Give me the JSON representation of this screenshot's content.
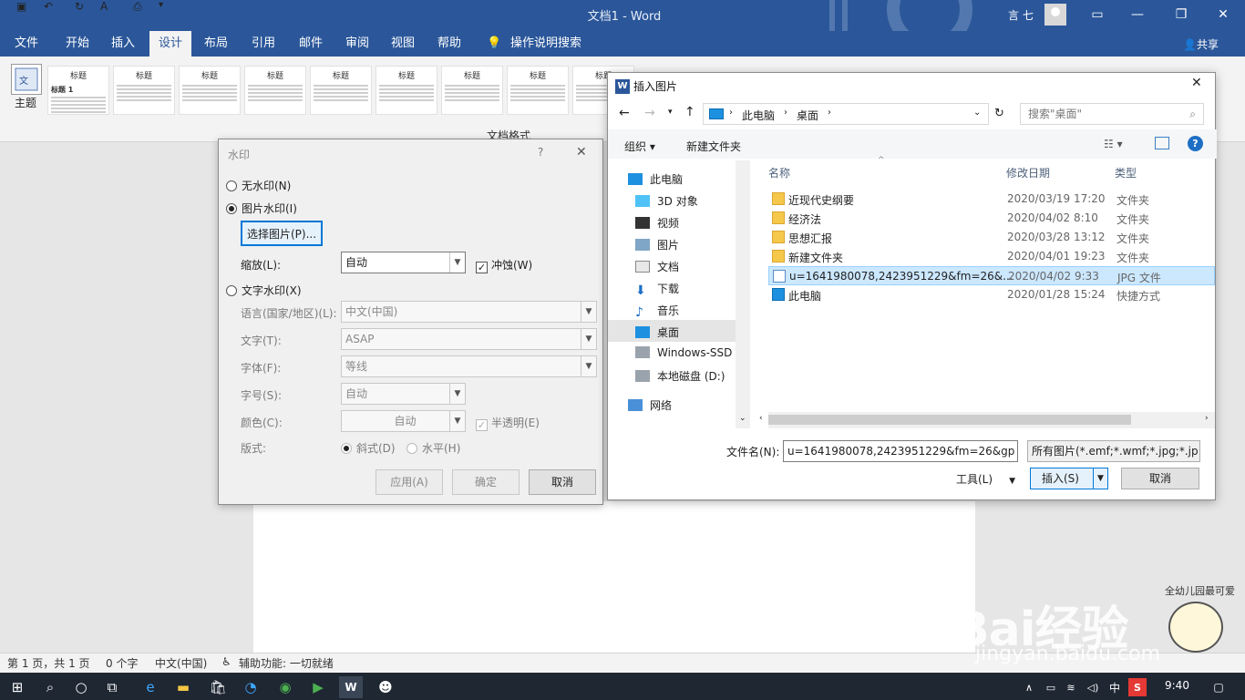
{
  "titlebar": {
    "doc_title": "文档1  -  Word",
    "user": "言 七"
  },
  "tabs": [
    "文件",
    "开始",
    "插入",
    "设计",
    "布局",
    "引用",
    "邮件",
    "审阅",
    "视图",
    "帮助"
  ],
  "tell_me": "操作说明搜索",
  "share": "共享",
  "ribbon": {
    "theme_label": "主题",
    "thumb_title": "标题",
    "thumb_heading1": "标题 1",
    "docformat_label": "文档格式",
    "style_count": 9
  },
  "status": {
    "page": "第 1 页，共 1 页",
    "words": "0 个字",
    "lang": "中文(中国)",
    "accessibility": "辅助功能: 一切就绪"
  },
  "taskbar": {
    "time": "9:40"
  },
  "watermark_dialog": {
    "title": "水印",
    "no_watermark": "无水印(N)",
    "picture_watermark": "图片水印(I)",
    "select_picture": "选择图片(P)...",
    "scale_label": "缩放(L):",
    "scale_value": "自动",
    "washout": "冲蚀(W)",
    "text_watermark": "文字水印(X)",
    "language_label": "语言(国家/地区)(L):",
    "language_value": "中文(中国)",
    "text_label": "文字(T):",
    "text_value": "ASAP",
    "font_label": "字体(F):",
    "font_value": "等线",
    "size_label": "字号(S):",
    "size_value": "自动",
    "color_label": "颜色(C):",
    "color_value": "自动",
    "semitransparent": "半透明(E)",
    "layout_label": "版式:",
    "diagonal": "斜式(D)",
    "horizontal": "水平(H)",
    "apply": "应用(A)",
    "ok": "确定",
    "cancel": "取消"
  },
  "insert_dialog": {
    "title": "插入图片",
    "breadcrumb": [
      "此电脑",
      "桌面"
    ],
    "search_placeholder": "搜索\"桌面\"",
    "organize": "组织 ▾",
    "new_folder": "新建文件夹",
    "nav": [
      "此电脑",
      "3D 对象",
      "视频",
      "图片",
      "文档",
      "下载",
      "音乐",
      "桌面",
      "Windows-SSD",
      "本地磁盘 (D:)",
      "网络"
    ],
    "columns": {
      "name": "名称",
      "modified": "修改日期",
      "type": "类型"
    },
    "files": [
      {
        "name": "近现代史纲要",
        "date": "2020/03/19 17:20",
        "type": "文件夹"
      },
      {
        "name": "经济法",
        "date": "2020/04/02 8:10",
        "type": "文件夹"
      },
      {
        "name": "思想汇报",
        "date": "2020/03/28 13:12",
        "type": "文件夹"
      },
      {
        "name": "新建文件夹",
        "date": "2020/04/01 19:23",
        "type": "文件夹"
      },
      {
        "name": "u=1641980078,2423951229&fm=26&...",
        "date": "2020/04/02 9:33",
        "type": "JPG 文件"
      },
      {
        "name": "此电脑",
        "date": "2020/01/28 15:24",
        "type": "快捷方式"
      }
    ],
    "filename_label": "文件名(N):",
    "filename_value": "u=1641980078,2423951229&fm=26&gp",
    "filter_value": "所有图片(*.emf;*.wmf;*.jpg;*.jp",
    "tools": "工具(L)",
    "insert": "插入(S)",
    "cancel": "取消"
  },
  "watermark_overlay": {
    "brand": "Bai经验",
    "url": "jingyan.baidu.com",
    "tag": "全幼儿园最可爱"
  }
}
